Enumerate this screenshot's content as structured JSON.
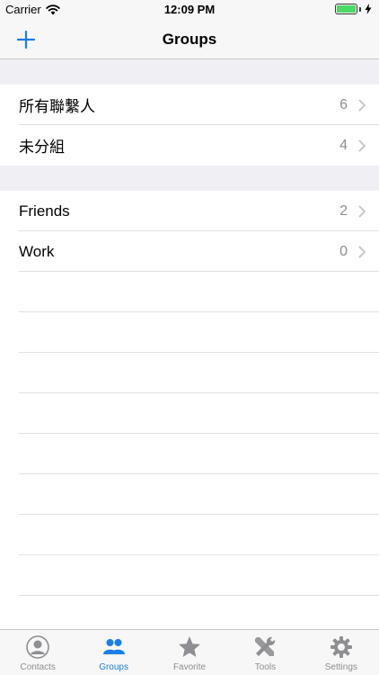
{
  "status_bar": {
    "carrier": "Carrier",
    "time": "12:09 PM",
    "battery_level": 1.0
  },
  "nav": {
    "title": "Groups",
    "add_icon": "plus-icon"
  },
  "sections": [
    {
      "rows": [
        {
          "label": "所有聯繫人",
          "count": "6"
        },
        {
          "label": "未分組",
          "count": "4"
        }
      ]
    },
    {
      "rows": [
        {
          "label": "Friends",
          "count": "2"
        },
        {
          "label": "Work",
          "count": "0"
        }
      ]
    }
  ],
  "tabs": [
    {
      "label": "Contacts",
      "icon": "person-circle-icon",
      "active": false
    },
    {
      "label": "Groups",
      "icon": "people-icon",
      "active": true
    },
    {
      "label": "Favorite",
      "icon": "star-icon",
      "active": false
    },
    {
      "label": "Tools",
      "icon": "tools-icon",
      "active": false
    },
    {
      "label": "Settings",
      "icon": "gear-icon",
      "active": false
    }
  ],
  "colors": {
    "accent": "#1a7ee6",
    "inactive": "#8e8e93",
    "battery": "#4cd964",
    "section_background": "#efeff4"
  }
}
